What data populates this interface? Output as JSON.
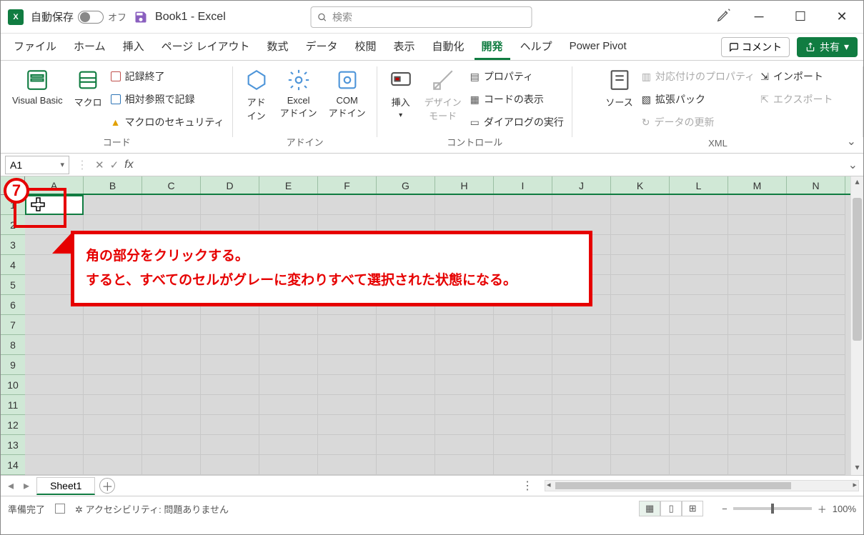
{
  "titlebar": {
    "autosave_label": "自動保存",
    "autosave_state": "オフ",
    "doc_title": "Book1 - Excel",
    "search_placeholder": "検索"
  },
  "tabs": {
    "items": [
      "ファイル",
      "ホーム",
      "挿入",
      "ページ レイアウト",
      "数式",
      "データ",
      "校閲",
      "表示",
      "自動化",
      "開発",
      "ヘルプ",
      "Power Pivot"
    ],
    "active_index": 9,
    "comment_btn": "コメント",
    "share_btn": "共有"
  },
  "ribbon": {
    "groups": [
      {
        "name": "コード",
        "big": [
          {
            "label": "Visual Basic"
          },
          {
            "label": "マクロ"
          }
        ],
        "small": [
          {
            "label": "記録終了",
            "disabled": false
          },
          {
            "label": "相対参照で記録",
            "disabled": false
          },
          {
            "label": "マクロのセキュリティ",
            "disabled": false
          }
        ]
      },
      {
        "name": "アドイン",
        "big": [
          {
            "label": "アド\nイン"
          },
          {
            "label": "Excel\nアドイン"
          },
          {
            "label": "COM\nアドイン"
          }
        ],
        "small": []
      },
      {
        "name": "コントロール",
        "big": [
          {
            "label": "挿入"
          },
          {
            "label": "デザイン\nモード",
            "disabled": true
          }
        ],
        "small": [
          {
            "label": "プロパティ"
          },
          {
            "label": "コードの表示"
          },
          {
            "label": "ダイアログの実行"
          }
        ]
      },
      {
        "name": "XML",
        "big": [
          {
            "label": "ソース"
          }
        ],
        "small": [
          {
            "label": "対応付けのプロパティ",
            "disabled": true
          },
          {
            "label": "拡張パック",
            "disabled": false
          },
          {
            "label": "データの更新",
            "disabled": true
          }
        ],
        "small2": [
          {
            "label": "インポート",
            "disabled": false
          },
          {
            "label": "エクスポート",
            "disabled": true
          }
        ]
      }
    ]
  },
  "formulabar": {
    "namebox": "A1",
    "fx_label": "fx",
    "formula_value": ""
  },
  "grid": {
    "columns": [
      "A",
      "B",
      "C",
      "D",
      "E",
      "F",
      "G",
      "H",
      "I",
      "J",
      "K",
      "L",
      "M",
      "N"
    ],
    "rows": [
      1,
      2,
      3,
      4,
      5,
      6,
      7,
      8,
      9,
      10,
      11,
      12,
      13,
      14
    ],
    "active_cell": "A1"
  },
  "annotation": {
    "step_number": "7",
    "line1": "角の部分をクリックする。",
    "line2": "すると、すべてのセルがグレーに変わりすべて選択された状態になる。"
  },
  "sheets": {
    "tabs": [
      "Sheet1"
    ],
    "active_index": 0
  },
  "statusbar": {
    "ready": "準備完了",
    "accessibility": "アクセシビリティ: 問題ありません",
    "zoom": "100%"
  }
}
